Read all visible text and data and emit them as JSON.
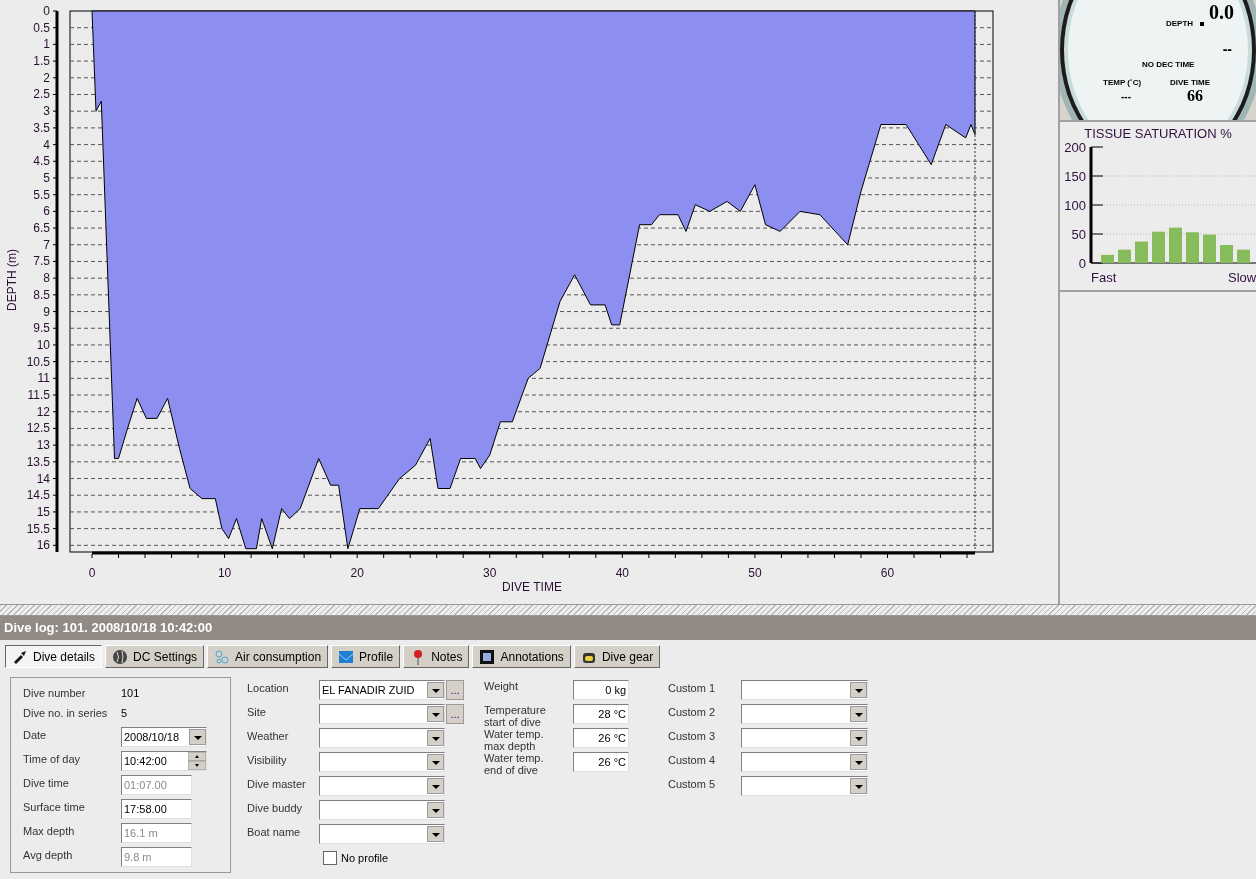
{
  "depth_chart": {
    "chart_data": {
      "type": "area",
      "xlabel": "DIVE TIME",
      "ylabel": "DEPTH (m)",
      "x": [
        0,
        0.3,
        0.7,
        1.7,
        2.0,
        2.6,
        3.4,
        4.1,
        4.9,
        5.7,
        6.6,
        7.4,
        8.3,
        9.3,
        9.8,
        10.3,
        10.9,
        11.6,
        12.4,
        12.8,
        13.6,
        14.3,
        14.9,
        15.7,
        17.1,
        18.0,
        18.6,
        19.3,
        20.2,
        21.6,
        23.2,
        24.4,
        25.5,
        26.1,
        27.0,
        27.8,
        28.9,
        29.3,
        30.0,
        30.8,
        31.7,
        32.9,
        33.8,
        35.3,
        36.4,
        37.6,
        38.7,
        39.2,
        39.8,
        41.3,
        42.2,
        42.8,
        44.2,
        44.8,
        45.5,
        46.6,
        47.9,
        48.9,
        50.0,
        50.8,
        51.9,
        53.4,
        54.9,
        57.0,
        58.0,
        59.5,
        61.4,
        63.3,
        64.4,
        65.9,
        66.3,
        66.6
      ],
      "values": [
        0,
        3.0,
        2.7,
        13.4,
        13.4,
        12.6,
        11.6,
        12.2,
        12.2,
        11.6,
        13.1,
        14.3,
        14.6,
        14.6,
        15.5,
        15.8,
        15.2,
        16.1,
        16.1,
        15.2,
        16.1,
        14.9,
        15.2,
        14.9,
        13.4,
        14.2,
        14.2,
        16.1,
        14.9,
        14.9,
        14.0,
        13.6,
        12.8,
        14.3,
        14.3,
        13.4,
        13.4,
        13.7,
        13.3,
        12.3,
        12.3,
        11.0,
        10.7,
        8.7,
        7.9,
        8.8,
        8.8,
        9.4,
        9.4,
        6.4,
        6.4,
        6.1,
        6.1,
        6.6,
        5.8,
        6.0,
        5.7,
        6.0,
        5.2,
        6.4,
        6.6,
        6.0,
        6.1,
        7.0,
        5.4,
        3.4,
        3.4,
        4.6,
        3.4,
        3.8,
        3.4,
        3.7
      ],
      "xlim": [
        0,
        66.6
      ],
      "ylim": [
        16.2,
        0
      ],
      "grid": true,
      "xticks": [
        0,
        10,
        20,
        30,
        40,
        50,
        60
      ],
      "yticks": [
        0,
        0.5,
        1,
        1.5,
        2,
        2.5,
        3,
        3.5,
        4,
        4.5,
        5,
        5.5,
        6,
        6.5,
        7,
        7.5,
        8,
        8.5,
        9,
        9.5,
        10,
        10.5,
        11,
        11.5,
        12,
        12.5,
        13,
        13.5,
        14,
        14.5,
        15,
        15.5,
        16
      ]
    }
  },
  "gauge": {
    "depth": "0.0",
    "depth_label": "DEPTH",
    "deco": "--",
    "deco_label": "NO DEC TIME",
    "temp_label": "TEMP (˚C)",
    "temp": "---",
    "dive_time_label": "DIVE TIME",
    "dive_time": "66"
  },
  "tissue_saturation": {
    "chart_data": {
      "type": "bar",
      "title": "TISSUE SATURATION %",
      "values": [
        14,
        23,
        37,
        54,
        61,
        53,
        49,
        31,
        23
      ],
      "ylim": [
        0,
        200
      ],
      "yticks": [
        0,
        50,
        100,
        150,
        200
      ],
      "grid": true
    },
    "fast_label": "Fast",
    "slow_label": "Slow"
  },
  "dive_log_title": "Dive log: 101. 2008/10/18 10:42:00",
  "tabs": [
    {
      "label": "Dive details",
      "selected": true
    },
    {
      "label": "DC Settings",
      "selected": false
    },
    {
      "label": "Air consumption",
      "selected": false
    },
    {
      "label": "Profile",
      "selected": false
    },
    {
      "label": "Notes",
      "selected": false
    },
    {
      "label": "Annotations",
      "selected": false
    },
    {
      "label": "Dive gear",
      "selected": false
    }
  ],
  "summary": [
    {
      "kind": "text",
      "label": "Dive number",
      "value": "101",
      "disabled": false
    },
    {
      "kind": "text",
      "label": "Dive no. in series",
      "value": "5",
      "disabled": false
    },
    {
      "kind": "dropdown",
      "label": "Date",
      "value": "2008/10/18",
      "disabled": false
    },
    {
      "kind": "spinner",
      "label": "Time of day",
      "value": "10:42:00",
      "disabled": false
    },
    {
      "kind": "field",
      "label": "Dive time",
      "value": "01:07.00",
      "disabled": true
    },
    {
      "kind": "field",
      "label": "Surface time",
      "value": "17:58.00",
      "disabled": false
    },
    {
      "kind": "field",
      "label": "Max depth",
      "value": "16.1 m",
      "disabled": true
    },
    {
      "kind": "field",
      "label": "Avg depth",
      "value": "9.8 m",
      "disabled": true
    }
  ],
  "place_fields": [
    {
      "label": "Location",
      "value": "EL FANADIR ZUID",
      "browse": "..."
    },
    {
      "label": "Site",
      "browse": "..."
    },
    {
      "label": "Weather"
    },
    {
      "label": "Visibility"
    },
    {
      "label": "Dive master"
    },
    {
      "label": "Dive buddy"
    },
    {
      "label": "Boat name"
    }
  ],
  "no_profile": {
    "label": "No profile",
    "checked": false
  },
  "conditions": [
    {
      "label": "Weight",
      "value": "0 kg"
    },
    {
      "label": "Temperature start of dive",
      "value": "28 °C"
    },
    {
      "label": "Water temp. max depth",
      "value": "26 °C"
    },
    {
      "label": "Water temp. end of dive",
      "value": "26 °C"
    }
  ],
  "custom": [
    {
      "label": "Custom 1"
    },
    {
      "label": "Custom 2"
    },
    {
      "label": "Custom 3"
    },
    {
      "label": "Custom 4"
    },
    {
      "label": "Custom 5"
    }
  ]
}
